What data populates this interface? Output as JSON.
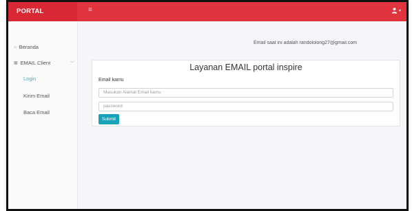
{
  "header": {
    "brand": "PORTAL",
    "menu_toggle_icon": "hamburger-icon",
    "user_icon": "user-icon",
    "caret": "▾",
    "colors": {
      "bar": "#e1343f",
      "brand_bg": "#d72834"
    }
  },
  "sidebar": {
    "items": [
      {
        "label": "Beranda",
        "icon": "home-icon"
      },
      {
        "label": "EMAIL Client",
        "icon": "grid-icon"
      },
      {
        "label": "Login"
      },
      {
        "label": "Kirim Email"
      },
      {
        "label": "Baca Email"
      }
    ],
    "active_color": "#2ab7c1"
  },
  "main": {
    "notice": "Email saat ini adalah randololong27@gmail.com",
    "card": {
      "title": "Layanan EMAIL portal inspire",
      "email_label": "Email kamu",
      "email_placeholder": "Masukan Alamat Email kamu",
      "password_placeholder": "password",
      "submit_label": "Submit",
      "submit_color": "#17a2b8"
    }
  }
}
